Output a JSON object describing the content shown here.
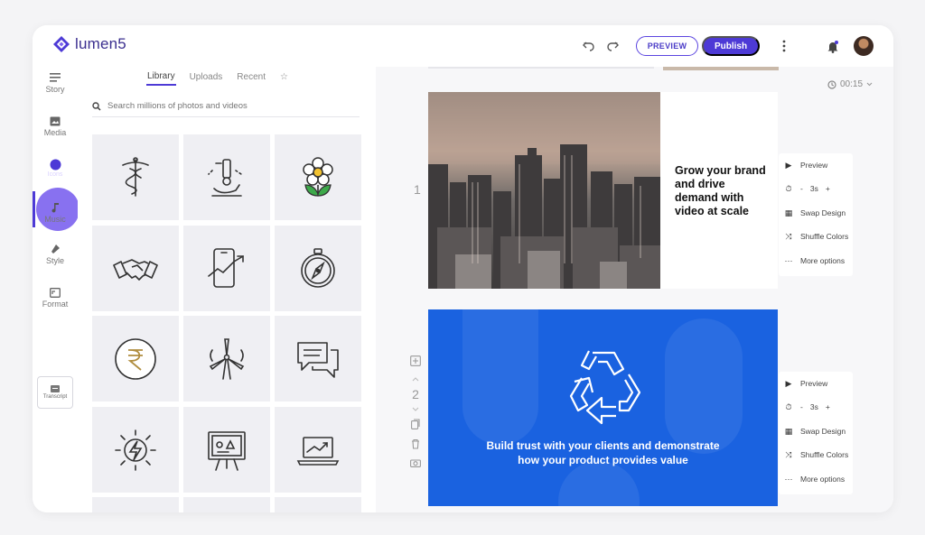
{
  "app": {
    "logo_text": "lumen5"
  },
  "header": {
    "preview_label": "PREVIEW",
    "publish_label": "Publish",
    "icons": [
      "undo-icon",
      "redo-icon",
      "more-vertical-icon",
      "bell-icon",
      "avatar"
    ]
  },
  "rail": {
    "items": [
      {
        "label": "Story",
        "icon": "story-icon"
      },
      {
        "label": "Media",
        "icon": "media-icon"
      },
      {
        "label": "Icons",
        "icon": "icons-icon"
      },
      {
        "label": "Music",
        "icon": "music-icon"
      },
      {
        "label": "Style",
        "icon": "style-icon"
      },
      {
        "label": "Format",
        "icon": "format-icon"
      }
    ],
    "transcript_label": "Transcript"
  },
  "library": {
    "tabs": [
      "Library",
      "Uploads",
      "Recent",
      "☆"
    ],
    "active_tab": "Library",
    "search_placeholder": "Search millions of photos and videos",
    "tiles": [
      "caduceus-icon",
      "microscope-icon",
      "flower-icon",
      "handshake-icon",
      "phone-chart-icon",
      "compass-icon",
      "rupee-icon",
      "wind-turbine-icon",
      "chat-bubbles-icon",
      "power-bolt-icon",
      "presentation-board-icon",
      "laptop-chart-icon"
    ]
  },
  "canvas": {
    "duration": "00:15",
    "scenes": [
      {
        "number": "1",
        "text": "Grow your brand and drive demand with video at scale"
      },
      {
        "number": "2",
        "text_line1": "Build trust with your clients and demonstrate",
        "text_line2": "how your product provides value"
      }
    ],
    "scene_options": {
      "preview": "Preview",
      "duration": "3s",
      "minus": "-",
      "plus": "+",
      "swap_design": "Swap Design",
      "shuffle_colors": "Shuffle Colors",
      "more_options": "More options"
    }
  },
  "colors": {
    "accent": "#4d3ad6",
    "scene_blue": "#1a62e0",
    "tile_bg": "#efeff3"
  }
}
